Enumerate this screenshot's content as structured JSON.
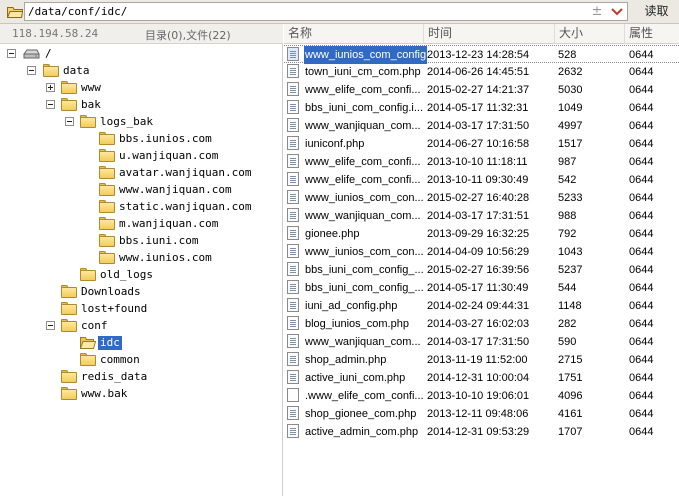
{
  "path_bar": {
    "path": "/data/conf/idc/",
    "add_symbol": "±",
    "read_button": "读取"
  },
  "info_bar": {
    "ip": "118.194.58.24",
    "counts": "目录(0),文件(22)"
  },
  "tree": [
    {
      "label": "/",
      "icon": "drive-icon",
      "toggle": "minus"
    },
    {
      "label": "data",
      "icon": "folder-icon",
      "toggle": "minus"
    },
    {
      "label": "www",
      "icon": "folder-icon",
      "toggle": "plus"
    },
    {
      "label": "bak",
      "icon": "folder-icon",
      "toggle": "minus"
    },
    {
      "label": "logs_bak",
      "icon": "folder-icon",
      "toggle": "minus"
    },
    {
      "label": "bbs.iunios.com",
      "icon": "folder-icon",
      "toggle": ""
    },
    {
      "label": "u.wanjiquan.com",
      "icon": "folder-icon",
      "toggle": ""
    },
    {
      "label": "avatar.wanjiquan.com",
      "icon": "folder-icon",
      "toggle": ""
    },
    {
      "label": "www.wanjiquan.com",
      "icon": "folder-icon",
      "toggle": ""
    },
    {
      "label": "static.wanjiquan.com",
      "icon": "folder-icon",
      "toggle": ""
    },
    {
      "label": "m.wanjiquan.com",
      "icon": "folder-icon",
      "toggle": ""
    },
    {
      "label": "bbs.iuni.com",
      "icon": "folder-icon",
      "toggle": ""
    },
    {
      "label": "www.iunios.com",
      "icon": "folder-icon",
      "toggle": ""
    },
    {
      "label": "old_logs",
      "icon": "folder-icon",
      "toggle": ""
    },
    {
      "label": "Downloads",
      "icon": "folder-icon",
      "toggle": ""
    },
    {
      "label": "lost+found",
      "icon": "folder-icon",
      "toggle": ""
    },
    {
      "label": "conf",
      "icon": "folder-icon",
      "toggle": "minus"
    },
    {
      "label": "idc",
      "icon": "open-folder-icon",
      "toggle": "",
      "selected": true
    },
    {
      "label": "common",
      "icon": "folder-icon",
      "toggle": ""
    },
    {
      "label": "redis_data",
      "icon": "folder-icon",
      "toggle": ""
    },
    {
      "label": "www.bak",
      "icon": "folder-icon",
      "toggle": ""
    }
  ],
  "list": {
    "columns": [
      "名称",
      "时间",
      "大小",
      "属性"
    ],
    "rows": [
      {
        "name": "www_iunios_com_config",
        "time": "2013-12-23 14:28:54",
        "size": "528",
        "attr": "0644",
        "selected": true
      },
      {
        "name": "town_iuni_cm_com.php",
        "time": "2014-06-26 14:45:51",
        "size": "2632",
        "attr": "0644"
      },
      {
        "name": "www_elife_com_confi...",
        "time": "2015-02-27 14:21:37",
        "size": "5030",
        "attr": "0644"
      },
      {
        "name": "bbs_iuni_com_config.i...",
        "time": "2014-05-17 11:32:31",
        "size": "1049",
        "attr": "0644"
      },
      {
        "name": "www_wanjiquan_com...",
        "time": "2014-03-17 17:31:50",
        "size": "4997",
        "attr": "0644"
      },
      {
        "name": "iuniconf.php",
        "time": "2014-06-27 10:16:58",
        "size": "1517",
        "attr": "0644"
      },
      {
        "name": "www_elife_com_confi...",
        "time": "2013-10-10 11:18:11",
        "size": "987",
        "attr": "0644"
      },
      {
        "name": "www_elife_com_confi...",
        "time": "2013-10-11 09:30:49",
        "size": "542",
        "attr": "0644"
      },
      {
        "name": "www_iunios_com_con...",
        "time": "2015-02-27 16:40:28",
        "size": "5233",
        "attr": "0644"
      },
      {
        "name": "www_wanjiquan_com...",
        "time": "2014-03-17 17:31:51",
        "size": "988",
        "attr": "0644"
      },
      {
        "name": "gionee.php",
        "time": "2013-09-29 16:32:25",
        "size": "792",
        "attr": "0644"
      },
      {
        "name": "www_iunios_com_con...",
        "time": "2014-04-09 10:56:29",
        "size": "1043",
        "attr": "0644"
      },
      {
        "name": "bbs_iuni_com_config_...",
        "time": "2015-02-27 16:39:56",
        "size": "5237",
        "attr": "0644"
      },
      {
        "name": "bbs_iuni_com_config_...",
        "time": "2014-05-17 11:30:49",
        "size": "544",
        "attr": "0644"
      },
      {
        "name": "iuni_ad_config.php",
        "time": "2014-02-24 09:44:31",
        "size": "1148",
        "attr": "0644"
      },
      {
        "name": "blog_iunios_com.php",
        "time": "2014-03-27 16:02:03",
        "size": "282",
        "attr": "0644"
      },
      {
        "name": "www_wanjiquan_com...",
        "time": "2014-03-17 17:31:50",
        "size": "590",
        "attr": "0644"
      },
      {
        "name": "shop_admin.php",
        "time": "2013-11-19 11:52:00",
        "size": "2715",
        "attr": "0644"
      },
      {
        "name": "active_iuni_com.php",
        "time": "2014-12-31 10:00:04",
        "size": "1751",
        "attr": "0644"
      },
      {
        "name": ".www_elife_com_confi...",
        "time": "2013-10-10 19:06:01",
        "size": "4096",
        "attr": "0644",
        "blank_icon": true
      },
      {
        "name": "shop_gionee_com.php",
        "time": "2013-12-11 09:48:06",
        "size": "4161",
        "attr": "0644"
      },
      {
        "name": "active_admin_com.php",
        "time": "2014-12-31 09:53:29",
        "size": "1707",
        "attr": "0644"
      }
    ]
  }
}
